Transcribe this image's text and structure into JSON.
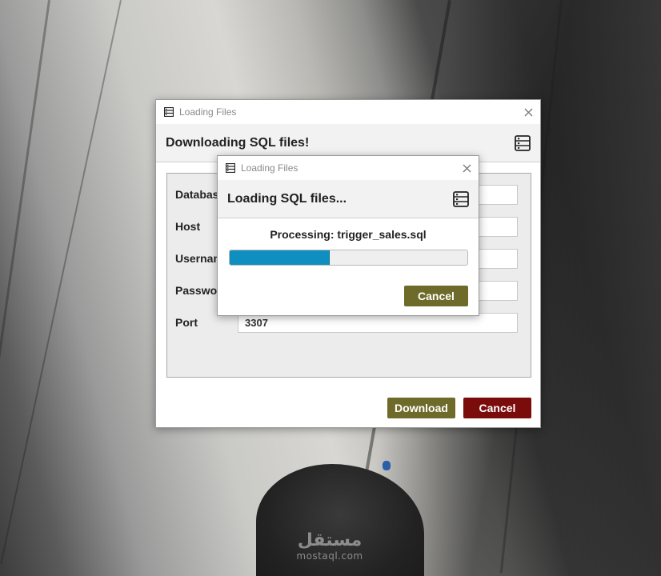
{
  "background": {
    "watermark_arabic": "مستقل",
    "watermark_latin": "mostaql.com"
  },
  "main_dialog": {
    "window_title": "Loading Files",
    "heading": "Downloading SQL files!",
    "fields": [
      {
        "label": "Database",
        "value": ""
      },
      {
        "label": "Host",
        "value": ""
      },
      {
        "label": "Username",
        "value": ""
      },
      {
        "label": "Password",
        "value": ""
      },
      {
        "label": "Port",
        "value": "3307"
      }
    ],
    "download_label": "Download",
    "cancel_label": "Cancel"
  },
  "loading_dialog": {
    "window_title": "Loading Files",
    "heading": "Loading SQL files...",
    "status": "Processing: trigger_sales.sql",
    "progress": 0.42,
    "cancel_label": "Cancel"
  },
  "colors": {
    "accent_olive": "#6e6a2a",
    "danger_red": "#7a0c0c",
    "progress_blue": "#0e8fc0"
  },
  "icons": {
    "title_icon": "database-icon",
    "header_icon": "server-list-icon",
    "close_icon": "close-icon"
  }
}
